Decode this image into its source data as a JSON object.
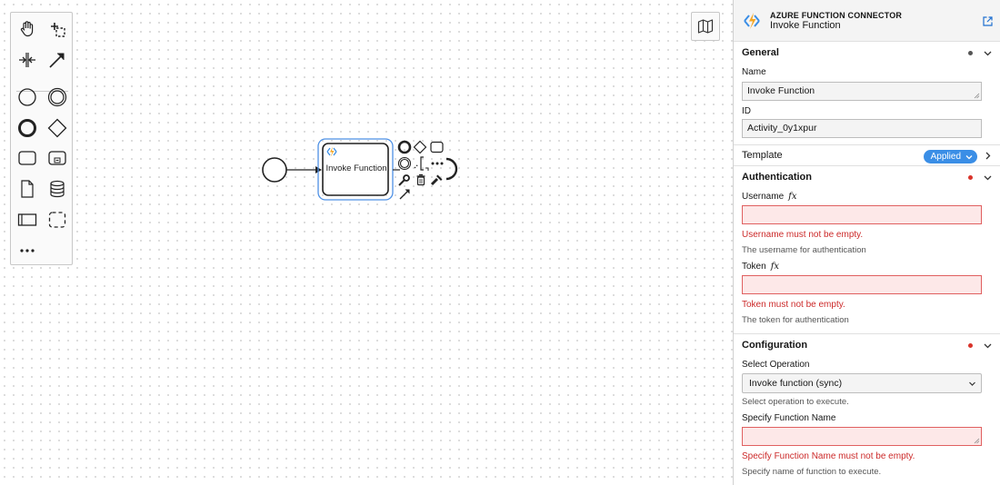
{
  "palette": {
    "tools": [
      "hand-tool",
      "lasso-tool",
      "space-tool",
      "global-connect-tool",
      "start-event",
      "intermediate-event",
      "end-event",
      "gateway",
      "task",
      "subprocess",
      "data-object",
      "data-store",
      "pool",
      "group",
      "more-tools"
    ]
  },
  "diagram": {
    "task_label": "Invoke Function"
  },
  "panel": {
    "header": {
      "type": "AZURE FUNCTION CONNECTOR",
      "name": "Invoke Function"
    },
    "general": {
      "title": "General",
      "name_label": "Name",
      "name_value": "Invoke Function",
      "id_label": "ID",
      "id_value": "Activity_0y1xpur"
    },
    "template": {
      "title": "Template",
      "badge": "Applied"
    },
    "authentication": {
      "title": "Authentication",
      "username_label": "Username",
      "username_fx": "fx",
      "username_error": "Username must not be empty.",
      "username_desc": "The username for authentication",
      "token_label": "Token",
      "token_fx": "fx",
      "token_error": "Token must not be empty.",
      "token_desc": "The token for authentication"
    },
    "configuration": {
      "title": "Configuration",
      "operation_label": "Select Operation",
      "operation_value": "Invoke function (sync)",
      "operation_desc": "Select operation to execute.",
      "function_label": "Specify Function Name",
      "function_error": "Specify Function Name must not be empty.",
      "function_desc": "Specify name of function to execute."
    }
  },
  "colors": {
    "accent": "#3a8ee6",
    "error": "#cc2a2a",
    "selection": "#4d90e5"
  }
}
